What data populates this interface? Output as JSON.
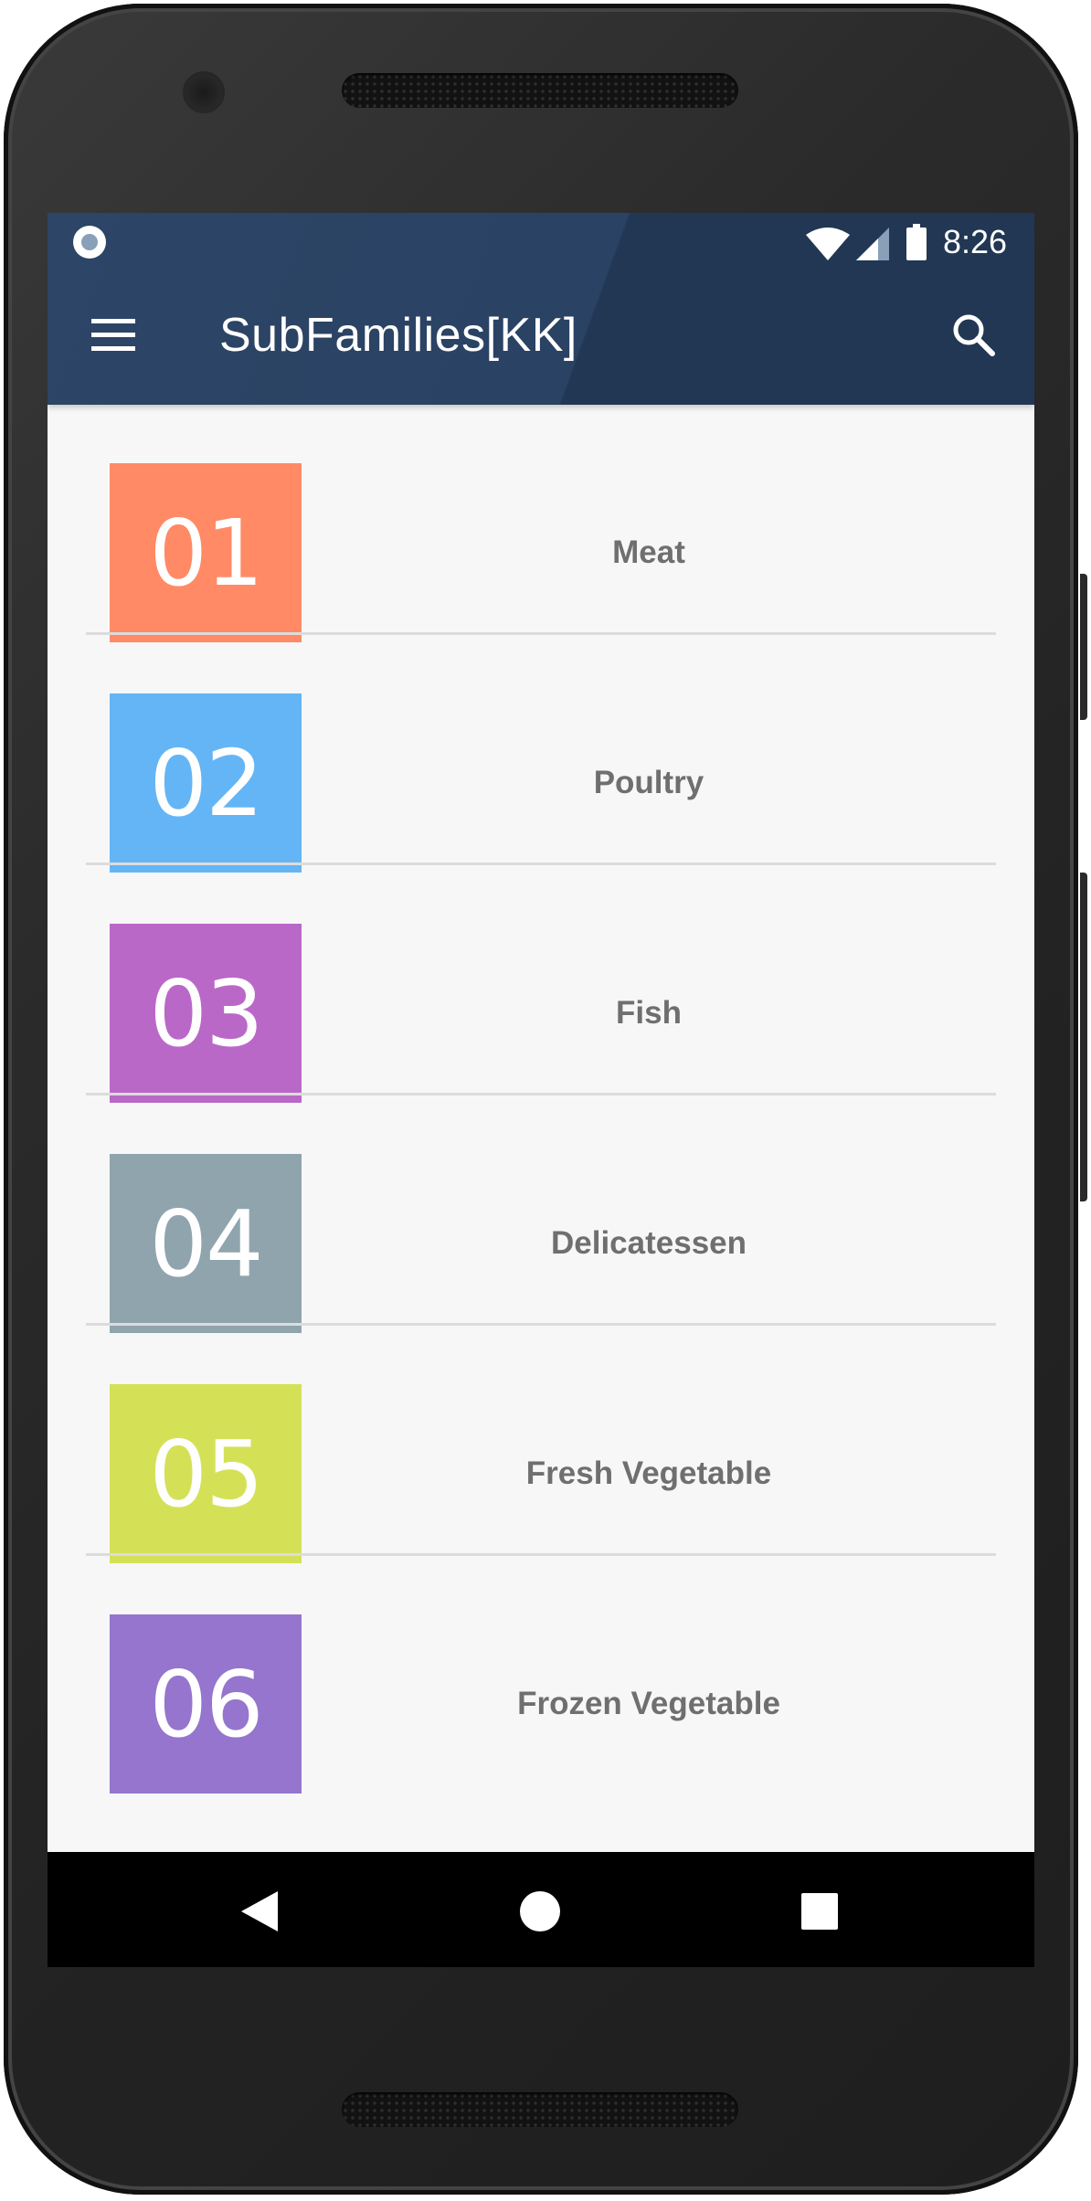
{
  "status_bar": {
    "time": "8:26"
  },
  "app_bar": {
    "title": "SubFamilies[KK]",
    "menu_icon": "hamburger-menu-icon",
    "search_icon": "search-icon",
    "color": "#243a57"
  },
  "list": {
    "items": [
      {
        "number": "01",
        "label": "Meat",
        "color": "#ff8a65"
      },
      {
        "number": "02",
        "label": "Poultry",
        "color": "#64b5f6"
      },
      {
        "number": "03",
        "label": "Fish",
        "color": "#ba68c8"
      },
      {
        "number": "04",
        "label": "Delicatessen",
        "color": "#90a4ae"
      },
      {
        "number": "05",
        "label": "Fresh Vegetable",
        "color": "#d4e157"
      },
      {
        "number": "06",
        "label": "Frozen Vegetable",
        "color": "#9575cd"
      }
    ]
  },
  "nav_bar": {
    "back_icon": "back-triangle-icon",
    "home_icon": "home-circle-icon",
    "recents_icon": "recents-square-icon"
  }
}
